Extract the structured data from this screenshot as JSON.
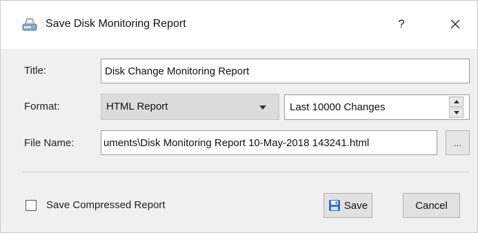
{
  "window": {
    "title": "Save Disk Monitoring Report",
    "help_label": "?",
    "app_icon": "disk-report-icon"
  },
  "form": {
    "title_label": "Title:",
    "title_value": "Disk Change Monitoring Report",
    "format_label": "Format:",
    "format_value": "HTML Report",
    "changes_value": "Last 10000 Changes",
    "filename_label": "File Name:",
    "filename_value": "uments\\Disk Monitoring Report 10-May-2018 143241.html",
    "browse_label": "..."
  },
  "footer": {
    "compress_label": "Save Compressed Report",
    "compress_checked": false,
    "save_label": "Save",
    "cancel_label": "Cancel"
  },
  "colors": {
    "titlebar": "#ffffff",
    "body": "#f0f0f0",
    "save_icon": "#2a73c9"
  }
}
